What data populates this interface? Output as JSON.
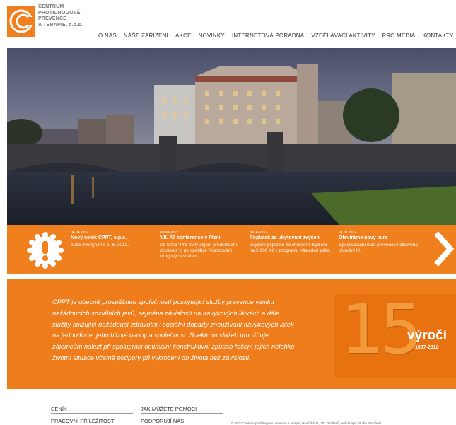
{
  "logo": {
    "lines": [
      "CENTRUM",
      "PROTIDROGOVÉ",
      "PREVENCE",
      "A TERAPIE, o.p.s."
    ]
  },
  "nav": {
    "items": [
      "O NÁS",
      "NAŠE ZAŘÍZENÍ",
      "AKCE",
      "NOVINKY",
      "INTERNETOVÁ PORADNA",
      "VZDĚLÁVACÍ AKTIVITY",
      "PRO MÉDIA",
      "KONTAKTY"
    ]
  },
  "news": [
    {
      "date": "06.04.2012",
      "title": "Nový ceník CPPT, o.p.s.",
      "text": "bude zveřejněn k 1. 6. 2012."
    },
    {
      "date": "02.04.2012",
      "title": "VII. AT konference v Plzni",
      "text": "na téma \"Pro malý zájem představení zrušeno\" o perspektivě financování drogových služeb"
    },
    {
      "date": "09.03.2012",
      "title": "Poplatek za ubytování zvýšen",
      "text": "Zvýšení poplatku za chráněné bydlení na 2 600 Kč v programu následné péče."
    },
    {
      "date": "01.02.2012",
      "title": "Otevíráme nový kurz",
      "text": "Specializační kurz prevence rizikového chování III."
    }
  ],
  "intro": {
    "text": "CPPT je obecně prospěšnou společností poskytující služby prevence vzniku nežádoucích sociálních jevů, zejména závislostí na návykových látkách a dále služby snižující nežádoucí zdravotní i sociální dopady zneužívání návykových látek na jednotlivce, jeho blízké osoby a společnost. Spektrum služeb umožňuje zájemcům nalézt při spolupráci optimální konstruktivní způsob řešení jejich nelehké životní situace včetně podpory při vykročení do života bez závislosti."
  },
  "anniversary": {
    "number": "15",
    "word": "výročí",
    "years": "1997-2012"
  },
  "footer": {
    "col1": [
      "CENÍK",
      "PRACOVNÍ PŘÍLEŽITOSTI"
    ],
    "col2": [
      "JAK MŮŽETE POMOCI",
      "PODPORUJÍ NÁS"
    ],
    "copyright": "© 2011 Centrum protidrogové prevence a terapie, Havířská 11, 301 00 Plzeň, webdesign: Studio Petrolead"
  },
  "colors": {
    "accent": "#f07f1e",
    "intro_bg": "#ef7d1b"
  }
}
